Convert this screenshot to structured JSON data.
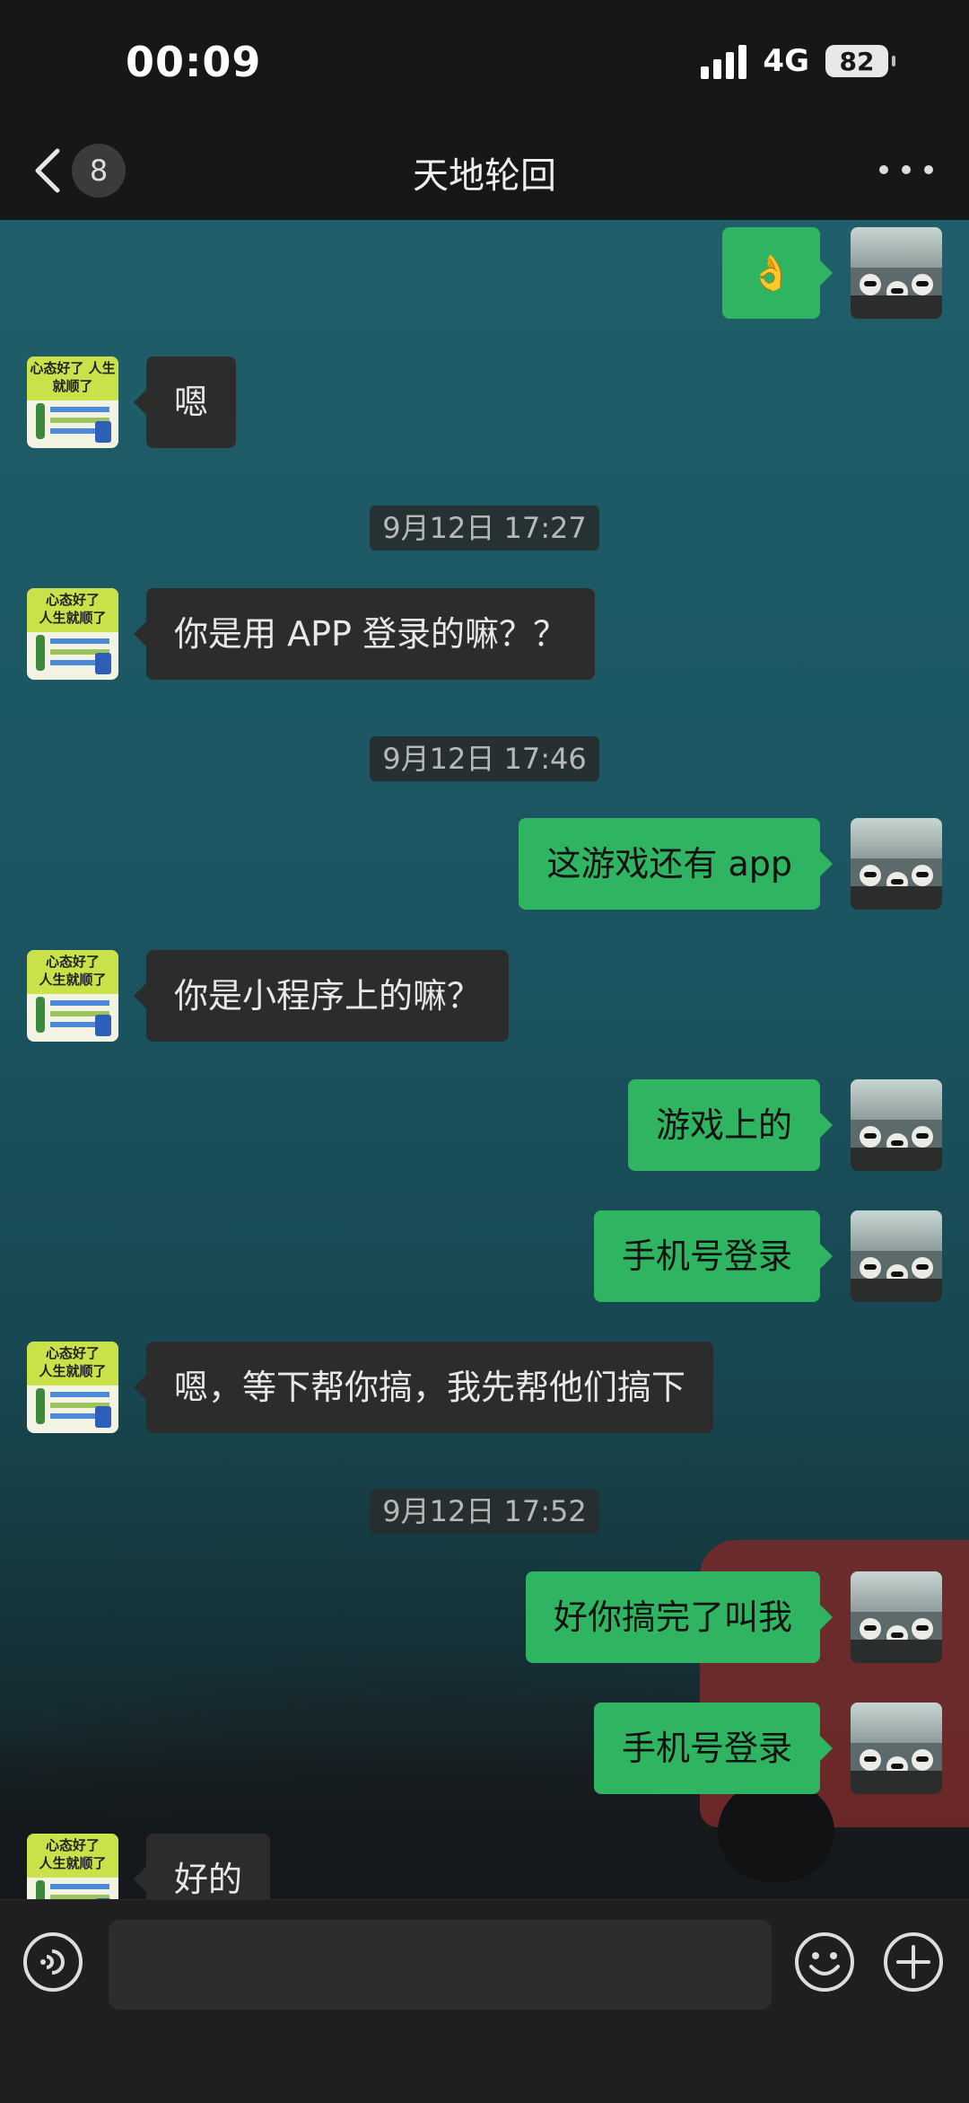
{
  "status": {
    "time": "00:09",
    "network": "4G",
    "battery": "82"
  },
  "header": {
    "title": "天地轮回",
    "unread_count": "8"
  },
  "messages": [
    {
      "side": "right",
      "text": "👌"
    },
    {
      "side": "left",
      "text": "嗯"
    },
    {
      "side": "time",
      "text": "9月12日 17:27"
    },
    {
      "side": "left",
      "text": "你是用 APP 登录的嘛？？"
    },
    {
      "side": "time",
      "text": "9月12日 17:46"
    },
    {
      "side": "right",
      "text": "这游戏还有 app"
    },
    {
      "side": "left",
      "text": "你是小程序上的嘛？"
    },
    {
      "side": "right",
      "text": "游戏上的"
    },
    {
      "side": "right",
      "text": "手机号登录"
    },
    {
      "side": "left",
      "text": "嗯，等下帮你搞，我先帮他们搞下"
    },
    {
      "side": "time",
      "text": "9月12日 17:52"
    },
    {
      "side": "right",
      "text": "好你搞完了叫我"
    },
    {
      "side": "right",
      "text": "手机号登录"
    },
    {
      "side": "left",
      "text": "好的"
    }
  ],
  "avatars": {
    "left": {
      "text": "心态好了 人生就顺了",
      "icon": "cactus-sticker-avatar"
    },
    "right": {
      "icon": "panda-group-avatar"
    }
  },
  "input": {
    "value": "",
    "placeholder": ""
  },
  "colors": {
    "sent": "#2fb562",
    "received": "#2c2c2c",
    "chat_bg": "#1f5e6a"
  }
}
